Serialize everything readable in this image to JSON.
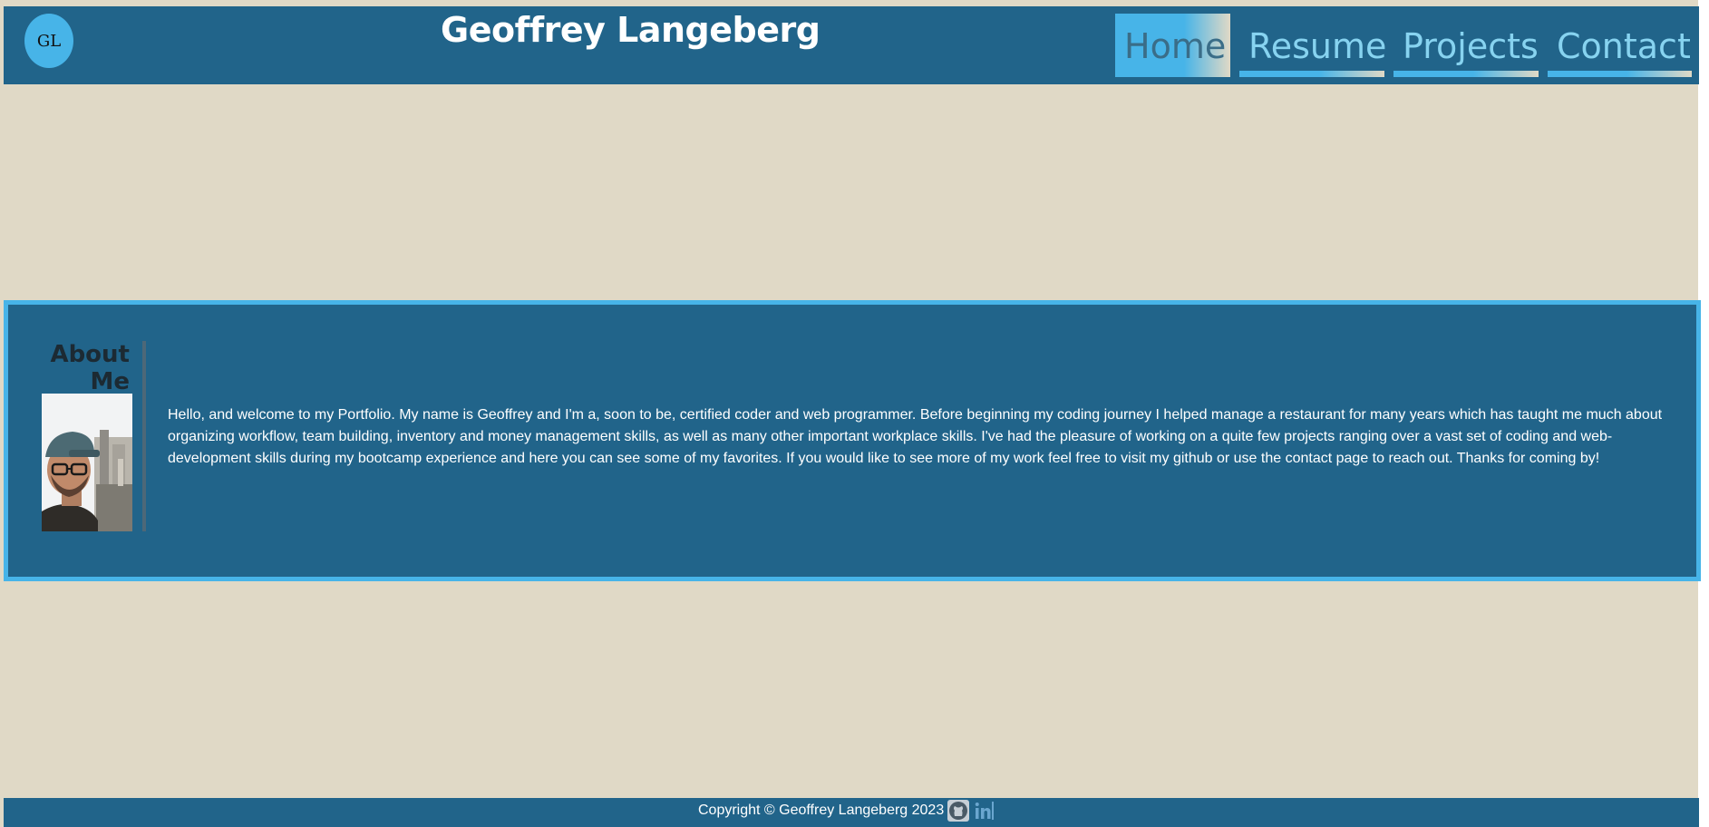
{
  "header": {
    "logo_text": "GL",
    "title": "Geoffrey Langeberg",
    "nav": [
      {
        "label": "Home",
        "active": true
      },
      {
        "label": "Resume",
        "active": false
      },
      {
        "label": "Projects",
        "active": false
      },
      {
        "label": "Contact",
        "active": false
      }
    ]
  },
  "about": {
    "heading": "About Me",
    "text": "Hello, and welcome to my Portfolio. My name is Geoffrey and I'm a, soon to be, certified coder and web programmer. Before beginning my coding journey I helped manage a restaurant for many years which has taught me much about organizing workflow, team building, inventory and money management skills, as well as many other important workplace skills. I've had the pleasure of working on a quite few projects ranging over a vast set of coding and web-development skills during my bootcamp experience and here you can see some of my favorites. If you would like to see more of my work feel free to visit my github or use the contact page to reach out. Thanks for coming by!",
    "portrait": "profile-photo"
  },
  "footer": {
    "copyright": "Copyright © Geoffrey Langeberg 2023",
    "icons": [
      "github-icon",
      "linkedin-icon"
    ]
  },
  "colors": {
    "background": "#e0d9c6",
    "primary": "#21648a",
    "accent": "#47b4e8",
    "nav_text": "#87d3f0"
  }
}
